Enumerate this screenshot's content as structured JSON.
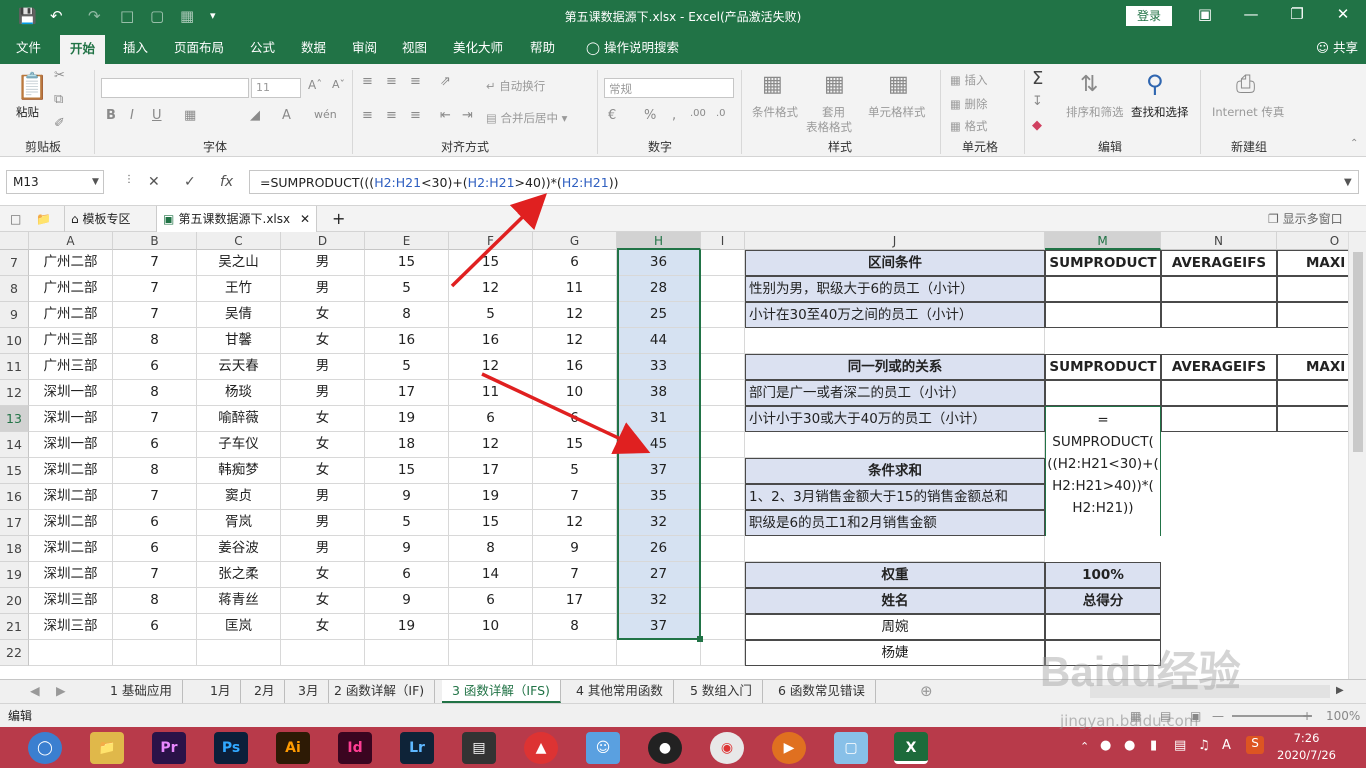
{
  "window": {
    "title": "第五课数据源下.xlsx  -  Excel(产品激活失败)",
    "login": "登录",
    "qat_icons": [
      "save-icon",
      "undo-icon",
      "redo-icon",
      "new-icon",
      "open-icon",
      "more-icon"
    ]
  },
  "menu": {
    "tabs": [
      "文件",
      "开始",
      "插入",
      "页面布局",
      "公式",
      "数据",
      "审阅",
      "视图",
      "美化大师",
      "帮助"
    ],
    "search": "操作说明搜索",
    "share": "共享"
  },
  "ribbon": {
    "clipboard": {
      "paste": "粘贴",
      "label": "剪贴板"
    },
    "font": {
      "size": "11",
      "label": "字体",
      "btns": [
        "B",
        "I",
        "U"
      ]
    },
    "align": {
      "wrap": "自动换行",
      "merge": "合并后居中",
      "label": "对齐方式"
    },
    "number": {
      "format": "常规",
      "label": "数字",
      "percent": "%",
      "comma": ","
    },
    "styles": {
      "cond": "条件格式",
      "table1": "套用",
      "table2": "表格格式",
      "cell": "单元格样式",
      "label": "样式"
    },
    "cells": {
      "insert": "插入",
      "delete": "删除",
      "format": "格式",
      "label": "单元格"
    },
    "editing": {
      "sort": "排序和筛选",
      "find": "查找和选择",
      "label": "编辑"
    },
    "newgrp": {
      "internet": "Internet 传真",
      "label": "新建组"
    }
  },
  "formula_bar": {
    "name_box": "M13",
    "formula": "=SUMPRODUCT(((H2:H21<30)+(H2:H21>40))*(H2:H21))",
    "fx": "fx"
  },
  "doc_tabs": {
    "template": "模板专区",
    "file": "第五课数据源下.xlsx",
    "multi": "显示多窗口"
  },
  "columns": [
    "A",
    "B",
    "C",
    "D",
    "E",
    "F",
    "G",
    "H",
    "I",
    "J",
    "M",
    "N",
    "O"
  ],
  "rows": [
    "7",
    "8",
    "9",
    "10",
    "11",
    "12",
    "13",
    "14",
    "15",
    "16",
    "17",
    "18",
    "19",
    "20",
    "21",
    "22"
  ],
  "table": [
    [
      "广州二部",
      "7",
      "吴之山",
      "男",
      "15",
      "15",
      "6",
      "36"
    ],
    [
      "广州二部",
      "7",
      "王竹",
      "男",
      "5",
      "12",
      "11",
      "28"
    ],
    [
      "广州二部",
      "7",
      "吴倩",
      "女",
      "8",
      "5",
      "12",
      "25"
    ],
    [
      "广州三部",
      "8",
      "甘馨",
      "女",
      "16",
      "16",
      "12",
      "44"
    ],
    [
      "广州三部",
      "6",
      "云天春",
      "男",
      "5",
      "12",
      "16",
      "33"
    ],
    [
      "深圳一部",
      "8",
      "杨琰",
      "男",
      "17",
      "11",
      "10",
      "38"
    ],
    [
      "深圳一部",
      "7",
      "喻醉薇",
      "女",
      "19",
      "6",
      "6",
      "31"
    ],
    [
      "深圳一部",
      "6",
      "子车仪",
      "女",
      "18",
      "12",
      "15",
      "45"
    ],
    [
      "深圳二部",
      "8",
      "韩痴梦",
      "女",
      "15",
      "17",
      "5",
      "37"
    ],
    [
      "深圳二部",
      "7",
      "窦贞",
      "男",
      "9",
      "19",
      "7",
      "35"
    ],
    [
      "深圳二部",
      "6",
      "胥岚",
      "男",
      "5",
      "15",
      "12",
      "32"
    ],
    [
      "深圳二部",
      "6",
      "姜谷波",
      "男",
      "9",
      "8",
      "9",
      "26"
    ],
    [
      "深圳二部",
      "7",
      "张之柔",
      "女",
      "6",
      "14",
      "7",
      "27"
    ],
    [
      "深圳三部",
      "8",
      "蒋青丝",
      "女",
      "9",
      "6",
      "17",
      "32"
    ],
    [
      "深圳三部",
      "6",
      "匡岚",
      "女",
      "19",
      "10",
      "8",
      "37"
    ]
  ],
  "right": {
    "interval_title": "区间条件",
    "h_sumproduct": "SUMPRODUCT",
    "h_averageifs": "AVERAGEIFS",
    "h_max": "MAXI",
    "interval_1": "性别为男，职级大于6的员工（小计）",
    "interval_2": "小计在30至40万之间的员工（小计）",
    "or_title": "同一列或的关系",
    "or_1": "部门是广一或者深二的员工（小计）",
    "or_2": "小计小于30或大于40万的员工（小计）",
    "editing_cell": "=\nSUMPRODUCT(\n((H2:H21<30)+(\nH2:H21>40))*(\nH2:H21))",
    "sum_title": "条件求和",
    "sum_1": "1、2、3月销售金额大于15的销售金额总和",
    "sum_2": "职级是6的员工1和2月销售金额",
    "weight": "权重",
    "weight_val": "100%",
    "name": "姓名",
    "score": "总得分",
    "p1": "周婉",
    "p2": "杨婕"
  },
  "sheets": [
    "1 基础应用",
    "1月",
    "2月",
    "3月",
    "2 函数详解（IF)",
    "3 函数详解（IFS)",
    "4 其他常用函数",
    "5 数组入门",
    "6 函数常见错误"
  ],
  "status": {
    "mode": "编辑",
    "zoom": "100%"
  },
  "taskbar": {
    "apps": [
      "Pr",
      "Ps",
      "Ai",
      "Id",
      "Lr"
    ],
    "time": "7:26",
    "date": "2020/7/26"
  },
  "watermark": "Baidu经验",
  "watermark_url": "jingyan.baidu.com",
  "colors": {
    "excel_green": "#217346",
    "header_fill": "#dbe1f1",
    "selection": "#d6e2f2",
    "arrow": "#e02020",
    "taskbar": "#b83a4a"
  }
}
